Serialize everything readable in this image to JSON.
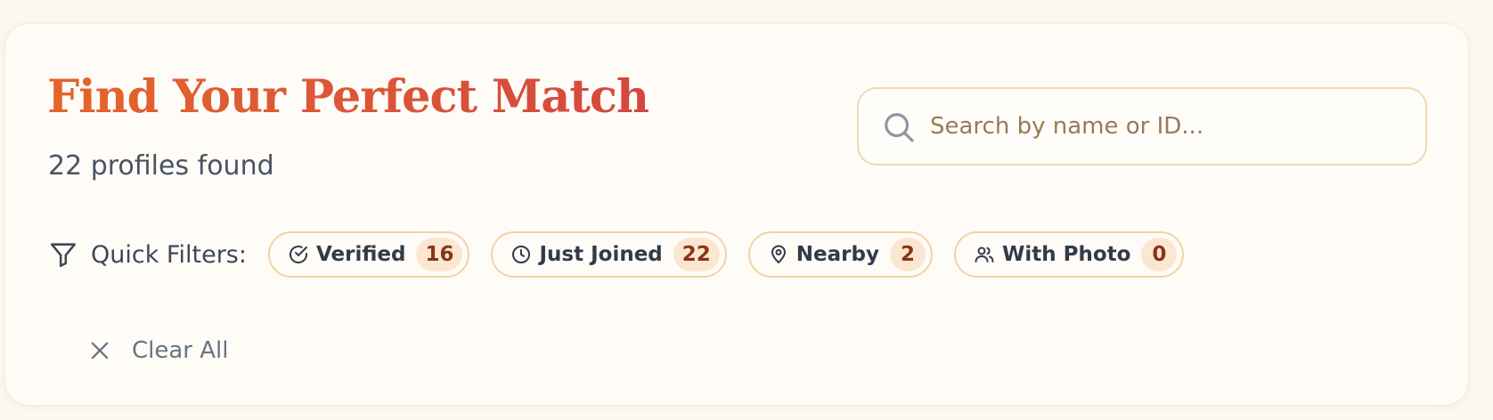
{
  "header": {
    "title": "Find Your Perfect Match",
    "count_text": "22 profiles found"
  },
  "search": {
    "placeholder": "Search by name or ID...",
    "value": "",
    "icon": "search-icon"
  },
  "filters": {
    "label": "Quick Filters:",
    "icon": "funnel-icon",
    "chips": [
      {
        "label": "Verified",
        "count": "16",
        "icon": "check-circle-icon"
      },
      {
        "label": "Just Joined",
        "count": "22",
        "icon": "clock-icon"
      },
      {
        "label": "Nearby",
        "count": "2",
        "icon": "map-pin-icon"
      },
      {
        "label": "With Photo",
        "count": "0",
        "icon": "users-icon"
      }
    ],
    "clear_label": "Clear All"
  },
  "colors": {
    "accent": "#d9532f",
    "chip_border": "#f1d3a6",
    "badge_bg": "#fbe7d1",
    "badge_text": "#8a3514"
  }
}
